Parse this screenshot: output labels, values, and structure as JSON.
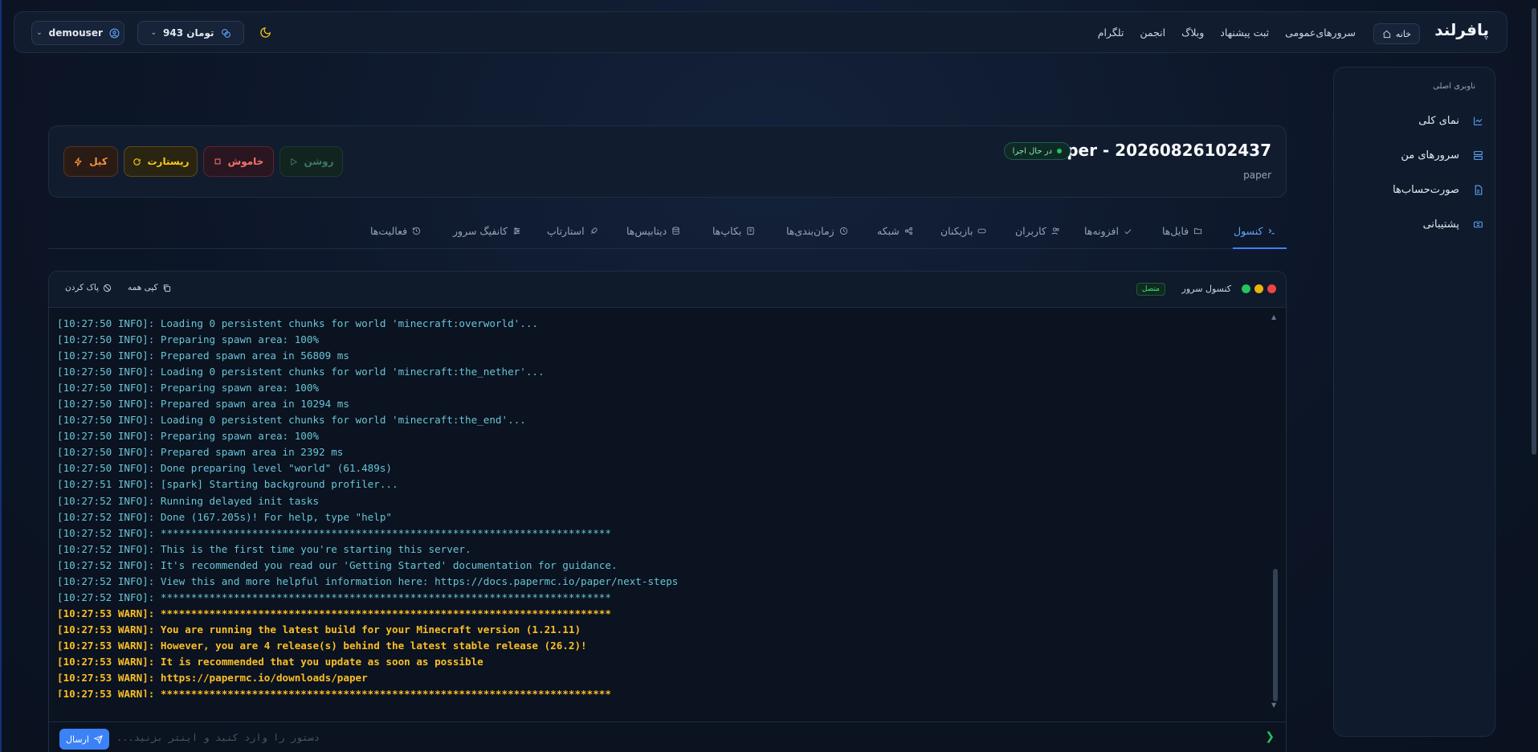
{
  "topnav": {
    "brand": "پافرلند",
    "home_label": "خانه",
    "links": [
      "سرورهای‌عمومی",
      "ثبت پیشنهاد",
      "وبلاگ",
      "انجمن",
      "تلگرام"
    ],
    "wallet": "943 تومان",
    "username": "demouser"
  },
  "sidebar": {
    "title": "ناوبری اصلی",
    "items": [
      {
        "label": "نمای کلی",
        "icon": "chart-icon"
      },
      {
        "label": "سرورهای من",
        "icon": "server-icon"
      },
      {
        "label": "صورت‌حساب‌ها",
        "icon": "invoice-icon"
      },
      {
        "label": "پشتیبانی",
        "icon": "ticket-icon"
      }
    ]
  },
  "server": {
    "name": "paper - 20260826102437",
    "subtitle": "paper",
    "status": "در حال اجرا",
    "buttons": {
      "start": "روشن",
      "stop": "خاموش",
      "restart": "ریستارت",
      "kill": "کیل"
    }
  },
  "tabs": [
    {
      "label": "کنسول",
      "icon": "terminal-icon",
      "active": true
    },
    {
      "label": "فایل‌ها",
      "icon": "folder-icon"
    },
    {
      "label": "افزونه‌ها",
      "icon": "plugin-icon"
    },
    {
      "label": "کاربران",
      "icon": "users-icon"
    },
    {
      "label": "بازیکنان",
      "icon": "gamepad-icon"
    },
    {
      "label": "شبکه",
      "icon": "network-icon"
    },
    {
      "label": "زمان‌بندی‌ها",
      "icon": "clock-icon"
    },
    {
      "label": "بکاپ‌ها",
      "icon": "archive-icon"
    },
    {
      "label": "دیتابیس‌ها",
      "icon": "database-icon"
    },
    {
      "label": "استارتاپ",
      "icon": "rocket-icon"
    },
    {
      "label": "کانفیگ سرور",
      "icon": "sliders-icon"
    },
    {
      "label": "فعالیت‌ها",
      "icon": "history-icon"
    }
  ],
  "console": {
    "title": "کنسول سرور",
    "connection": "متصل",
    "copy_all": "کپی همه",
    "clear": "پاک کردن",
    "input_placeholder": "دستور را وارد کنید و اینتر بزنید...",
    "send": "ارسال",
    "lines": [
      {
        "text": "[10:27:50 INFO]: Loading 0 persistent chunks for world 'minecraft:overworld'...",
        "level": "info"
      },
      {
        "text": "[10:27:50 INFO]: Preparing spawn area: 100%",
        "level": "info"
      },
      {
        "text": "[10:27:50 INFO]: Prepared spawn area in 56809 ms",
        "level": "info"
      },
      {
        "text": "[10:27:50 INFO]: Loading 0 persistent chunks for world 'minecraft:the_nether'...",
        "level": "info"
      },
      {
        "text": "[10:27:50 INFO]: Preparing spawn area: 100%",
        "level": "info"
      },
      {
        "text": "[10:27:50 INFO]: Prepared spawn area in 10294 ms",
        "level": "info"
      },
      {
        "text": "[10:27:50 INFO]: Loading 0 persistent chunks for world 'minecraft:the_end'...",
        "level": "info"
      },
      {
        "text": "[10:27:50 INFO]: Preparing spawn area: 100%",
        "level": "info"
      },
      {
        "text": "[10:27:50 INFO]: Prepared spawn area in 2392 ms",
        "level": "info"
      },
      {
        "text": "[10:27:50 INFO]: Done preparing level \"world\" (61.489s)",
        "level": "info"
      },
      {
        "text": "[10:27:51 INFO]: [spark] Starting background profiler...",
        "level": "info"
      },
      {
        "text": "[10:27:52 INFO]: Running delayed init tasks",
        "level": "info"
      },
      {
        "text": "[10:27:52 INFO]: Done (167.205s)! For help, type \"help\"",
        "level": "info"
      },
      {
        "text": "[10:27:52 INFO]: **************************************************************************",
        "level": "info"
      },
      {
        "text": "[10:27:52 INFO]: This is the first time you're starting this server.",
        "level": "info"
      },
      {
        "text": "[10:27:52 INFO]: It's recommended you read our 'Getting Started' documentation for guidance.",
        "level": "info"
      },
      {
        "text": "[10:27:52 INFO]: View this and more helpful information here: https://docs.papermc.io/paper/next-steps",
        "level": "info"
      },
      {
        "text": "[10:27:52 INFO]: **************************************************************************",
        "level": "info"
      },
      {
        "text": "[10:27:53 WARN]: **************************************************************************",
        "level": "warn"
      },
      {
        "text": "[10:27:53 WARN]: You are running the latest build for your Minecraft version (1.21.11)",
        "level": "warn"
      },
      {
        "text": "[10:27:53 WARN]: However, you are 4 release(s) behind the latest stable release (26.2)!",
        "level": "warn"
      },
      {
        "text": "[10:27:53 WARN]: It is recommended that you update as soon as possible",
        "level": "warn"
      },
      {
        "text": "[10:27:53 WARN]: https://papermc.io/downloads/paper",
        "level": "warn"
      },
      {
        "text": "[10:27:53 WARN]: **************************************************************************",
        "level": "warn"
      }
    ]
  },
  "colors": {
    "accent": "#3b82f6",
    "info_text": "#67c5d6",
    "warn_text": "#fbbf24",
    "success": "#22c55e"
  }
}
